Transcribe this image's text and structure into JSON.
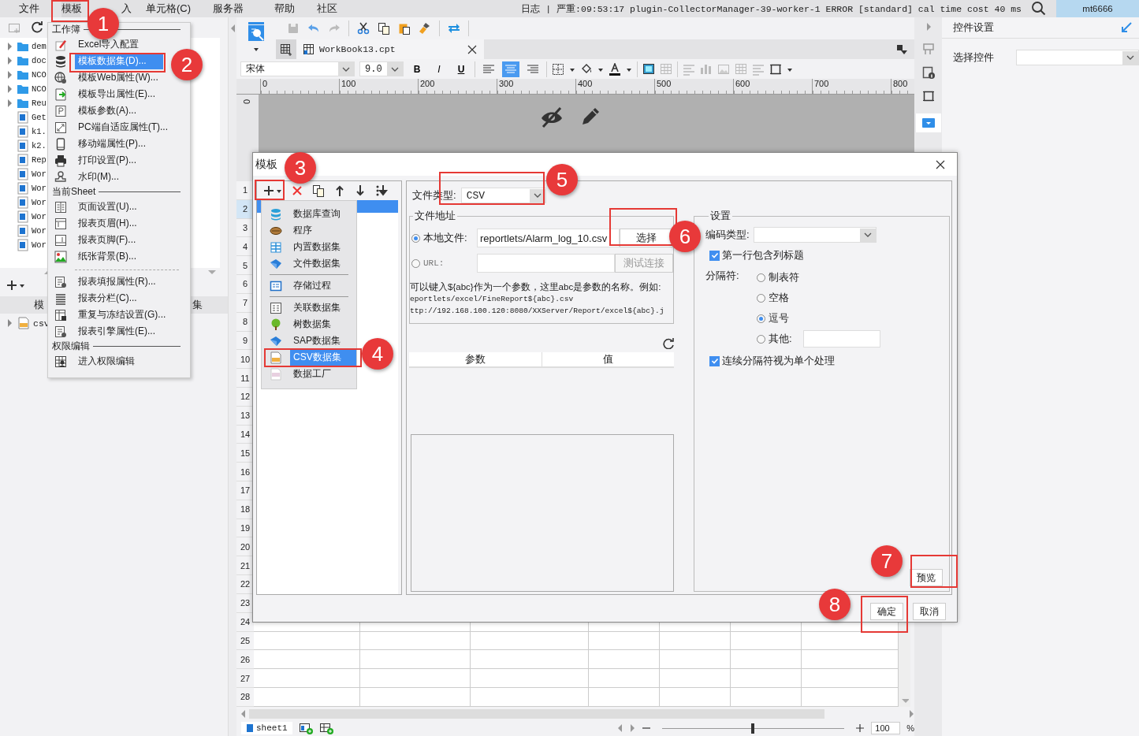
{
  "menubar": {
    "items": [
      {
        "label": "文件",
        "selected": false
      },
      {
        "label": "模板",
        "selected": true
      },
      {
        "label": "入",
        "selected": false
      },
      {
        "label": "单元格(C)",
        "selected": false
      },
      {
        "label": "服务器",
        "selected": false
      },
      {
        "label": "帮助",
        "selected": false
      },
      {
        "label": "社区",
        "selected": false
      }
    ],
    "log": "日志 | 严重:09:53:17 plugin-CollectorManager-39-worker-1 ERROR [standard] cal time cost 40 ms",
    "user": "mt6666"
  },
  "file_tree": {
    "items": [
      {
        "label": "dem",
        "kind": "folder"
      },
      {
        "label": "doc",
        "kind": "folder"
      },
      {
        "label": "NCO",
        "kind": "folder"
      },
      {
        "label": "NCO",
        "kind": "folder"
      },
      {
        "label": "Reu",
        "kind": "folder"
      },
      {
        "label": "Get",
        "kind": "file"
      },
      {
        "label": "k1.",
        "kind": "file"
      },
      {
        "label": "k2.",
        "kind": "file"
      },
      {
        "label": "Rep",
        "kind": "file"
      },
      {
        "label": "Wor",
        "kind": "file"
      },
      {
        "label": "Wor",
        "kind": "file"
      },
      {
        "label": "Wor",
        "kind": "file"
      },
      {
        "label": "Wor",
        "kind": "file"
      },
      {
        "label": "Wor",
        "kind": "file"
      },
      {
        "label": "Wor",
        "kind": "file"
      }
    ]
  },
  "dataset_panel": {
    "header_parts": [
      "模",
      "集"
    ],
    "items": [
      {
        "label": "csv"
      }
    ]
  },
  "template_menu": {
    "sections": [
      {
        "title": "工作簿",
        "groups": [
          [
            {
              "label": "Excel导入配置",
              "selected": false
            },
            {
              "label": "模板数据集(D)...",
              "selected": true
            },
            {
              "label": "模板Web属性(W)...",
              "selected": false
            },
            {
              "label": "模板导出属性(E)...",
              "selected": false
            },
            {
              "label": "模板参数(A)...",
              "selected": false
            },
            {
              "label": "PC端自适应属性(T)...",
              "selected": false
            },
            {
              "label": "移动端属性(P)...",
              "selected": false
            },
            {
              "label": "打印设置(P)...",
              "selected": false
            },
            {
              "label": "水印(M)...",
              "selected": false
            }
          ]
        ]
      },
      {
        "title": "当前Sheet",
        "groups": [
          [
            {
              "label": "页面设置(U)...",
              "selected": false
            },
            {
              "label": "报表页眉(H)...",
              "selected": false
            },
            {
              "label": "报表页脚(F)...",
              "selected": false
            },
            {
              "label": "纸张背景(B)...",
              "selected": false
            }
          ],
          [
            {
              "label": "报表填报属性(R)...",
              "selected": false
            },
            {
              "label": "报表分栏(C)...",
              "selected": false
            },
            {
              "label": "重复与冻结设置(G)...",
              "selected": false
            },
            {
              "label": "报表引擎属性(E)...",
              "selected": false
            }
          ]
        ]
      },
      {
        "title": "权限编辑",
        "groups": [
          [
            {
              "label": "进入权限编辑",
              "selected": false
            }
          ]
        ]
      }
    ]
  },
  "editor": {
    "tab": "WorkBook13.cpt",
    "font": "宋体",
    "font_size": "9.0",
    "text_style": [
      {
        "label": "B"
      },
      {
        "label": "I"
      },
      {
        "label": "U"
      }
    ],
    "align": [
      {
        "selected": false
      },
      {
        "selected": true
      },
      {
        "selected": false
      }
    ],
    "ruler": [
      "0",
      "100",
      "200",
      "300",
      "400",
      "500",
      "600",
      "700",
      "800"
    ],
    "vruler": "0",
    "rows": [
      {
        "label": "1",
        "selected": false
      },
      {
        "label": "2",
        "selected": true
      },
      {
        "label": "3",
        "selected": false
      },
      {
        "label": "4",
        "selected": false
      },
      {
        "label": "5",
        "selected": false
      },
      {
        "label": "6",
        "selected": false
      },
      {
        "label": "7",
        "selected": false
      },
      {
        "label": "8",
        "selected": false
      },
      {
        "label": "9",
        "selected": false
      },
      {
        "label": "10",
        "selected": false
      },
      {
        "label": "11",
        "selected": false
      },
      {
        "label": "12",
        "selected": false
      },
      {
        "label": "13",
        "selected": false
      },
      {
        "label": "14",
        "selected": false
      },
      {
        "label": "15",
        "selected": false
      },
      {
        "label": "16",
        "selected": false
      },
      {
        "label": "17",
        "selected": false
      },
      {
        "label": "18",
        "selected": false
      },
      {
        "label": "19",
        "selected": false
      },
      {
        "label": "20",
        "selected": false
      },
      {
        "label": "21",
        "selected": false
      },
      {
        "label": "22",
        "selected": false
      },
      {
        "label": "23",
        "selected": false
      },
      {
        "label": "24",
        "selected": false
      },
      {
        "label": "25",
        "selected": false
      },
      {
        "label": "26",
        "selected": false
      },
      {
        "label": "27",
        "selected": false
      },
      {
        "label": "28",
        "selected": false
      }
    ],
    "sheet_tab": "sheet1",
    "zoom_slider": {
      "level": 0.5
    },
    "zoom": "100",
    "zoom_unit": "%"
  },
  "right_panel": {
    "title": "控件设置",
    "select_label": "选择控件"
  },
  "dialog": {
    "title": "模板",
    "add_menu": {
      "groups": [
        [
          {
            "label": "数据库查询",
            "selected": false
          },
          {
            "label": "程序",
            "selected": false
          },
          {
            "label": "内置数据集",
            "selected": false
          },
          {
            "label": "文件数据集",
            "selected": false
          }
        ],
        [
          {
            "label": "存储过程",
            "selected": false
          }
        ],
        [
          {
            "label": "关联数据集",
            "selected": false
          },
          {
            "label": "树数据集",
            "selected": false
          },
          {
            "label": "SAP数据集",
            "selected": false
          },
          {
            "label": "CSV数据集",
            "selected": true
          },
          {
            "label": "数据工厂",
            "selected": false
          }
        ]
      ]
    },
    "file_type_label": "文件类型:",
    "file_type": "CSV",
    "address_legend": "文件地址",
    "local": {
      "label": "本地文件:",
      "selected": true,
      "value": "reportlets/Alarm_log_10.csv",
      "button": "选择"
    },
    "url": {
      "label": "URL:",
      "selected": false,
      "button": "测试连接",
      "disabled": true
    },
    "hint": [
      "可以键入${abc}作为一个参数，这里abc是参数的名称。例如:",
      "eportlets/excel/FineReport${abc}.csv",
      "ttp://192.168.100.120:8080/XXServer/Report/excel${abc}.j"
    ],
    "params_columns": [
      "参数",
      "值"
    ],
    "settings": {
      "legend": "设置",
      "encoding_label": "编码类型:",
      "first_row_header": {
        "label": "第一行包含列标题",
        "checked": true
      },
      "separator_label": "分隔符:",
      "separators": [
        {
          "label": "制表符",
          "selected": false
        },
        {
          "label": "空格",
          "selected": false
        },
        {
          "label": "逗号",
          "selected": true
        },
        {
          "label": "其他:",
          "selected": false
        }
      ],
      "merge": {
        "label": "连续分隔符视为单个处理",
        "checked": true
      }
    },
    "buttons": {
      "preview": "预览",
      "ok": "确定",
      "cancel": "取消"
    }
  },
  "callouts": [
    {
      "number": "1"
    },
    {
      "number": "2"
    },
    {
      "number": "3"
    },
    {
      "number": "4"
    },
    {
      "number": "5"
    },
    {
      "number": "6"
    },
    {
      "number": "7"
    },
    {
      "number": "8"
    }
  ]
}
